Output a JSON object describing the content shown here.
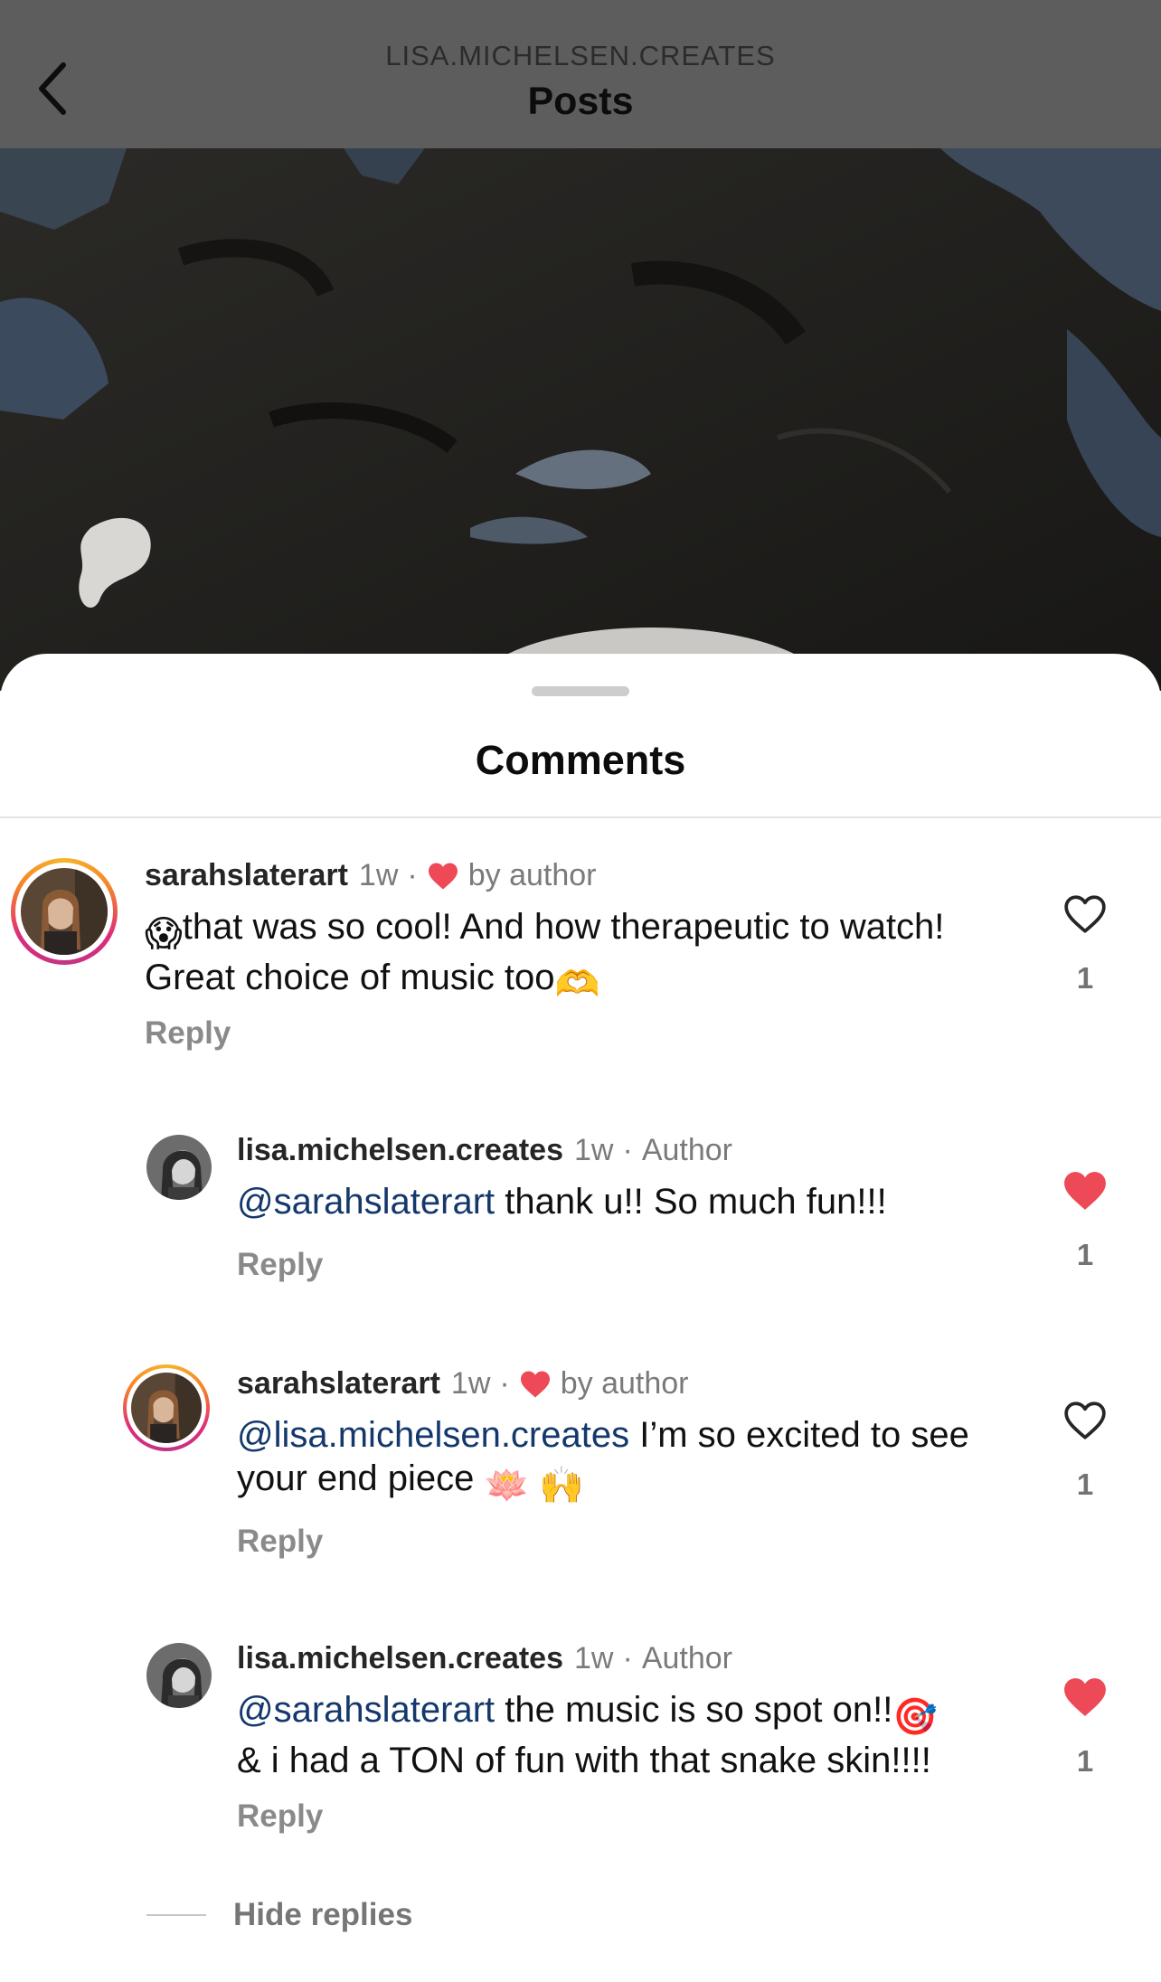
{
  "header": {
    "account_name": "LISA.MICHELSEN.CREATES",
    "title": "Posts",
    "background_color": "#5d5d5d"
  },
  "sheet": {
    "title": "Comments"
  },
  "comments": [
    {
      "username": "sarahslaterart",
      "time": "1w",
      "separator": "·",
      "badge": "by author",
      "text_emoji": "😱",
      "text": "that was so cool! And how therapeutic to watch! Great choice of music too",
      "text_end_emoji": "🫶",
      "reply_label": "Reply",
      "like_count": "1",
      "liked": false
    },
    {
      "username": "lisa.michelsen.creates",
      "time": "1w",
      "separator": "·",
      "badge": "Author",
      "mention": "@sarahslaterart",
      "text": " thank u!! So much fun!!!",
      "reply_label": "Reply",
      "like_count": "1",
      "liked": true
    },
    {
      "username": "sarahslaterart",
      "time": "1w",
      "separator": "·",
      "badge": "by author",
      "mention": "@lisa.michelsen.creates",
      "text": " I’m so excited to see your end piece ",
      "text_end_emoji": "🪷 🙌",
      "reply_label": "Reply",
      "like_count": "1",
      "liked": false
    },
    {
      "username": "lisa.michelsen.creates",
      "time": "1w",
      "separator": "·",
      "badge": "Author",
      "mention": "@sarahslaterart",
      "text": " the music is so spot on!!",
      "text_mid_emoji": "🎯",
      "text_cont": "& i had a TON of fun with that snake skin!!!!",
      "reply_label": "Reply",
      "like_count": "1",
      "liked": true
    }
  ],
  "hide_replies_label": "Hide replies",
  "colors": {
    "heart_red": "#ed4956",
    "mention_blue": "#14386c"
  }
}
